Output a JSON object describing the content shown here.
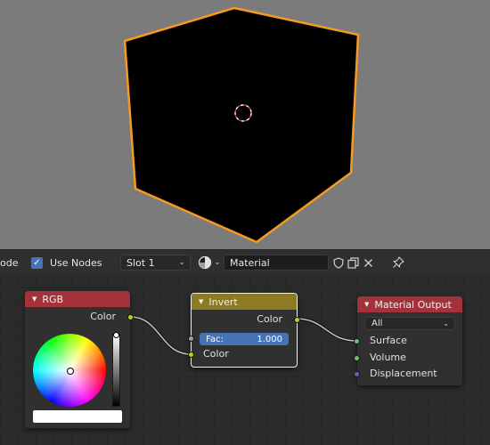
{
  "header": {
    "mode_label": "ode",
    "use_nodes_label": "Use Nodes",
    "use_nodes_checked": true,
    "slot_value": "Slot 1",
    "material_name": "Material"
  },
  "nodes": {
    "rgb": {
      "title": "RGB",
      "output_label": "Color"
    },
    "invert": {
      "title": "Invert",
      "output_label": "Color",
      "fac_label": "Fac:",
      "fac_value": "1.000",
      "input_label": "Color"
    },
    "material_output": {
      "title": "Material Output",
      "target_value": "All",
      "inputs": [
        "Surface",
        "Volume",
        "Displacement"
      ]
    }
  },
  "colors": {
    "viewport_bg": "#7b7b7b",
    "selection_outline": "#f59a22",
    "socket_color": "#c7c729",
    "socket_shader": "#63c763",
    "socket_vector": "#6363c7",
    "node_header_input": "#a3323a",
    "node_header_converter": "#8c7a25",
    "fac_slider": "#4772b3"
  }
}
